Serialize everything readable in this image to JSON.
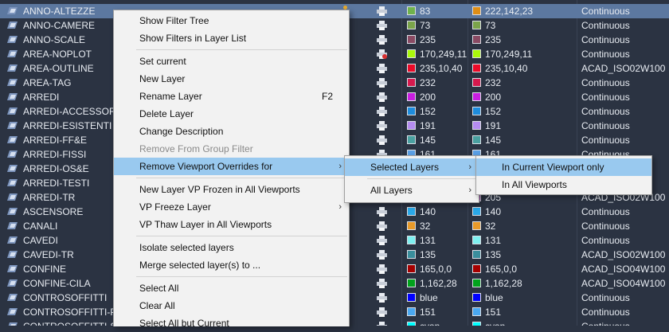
{
  "colors": {
    "selected_row": "#5c78a0",
    "table_bg": "#2b3342",
    "menu_bg": "#f2f2f2",
    "menu_highlight": "#99c9ef"
  },
  "layers": [
    {
      "name": "ANNO-ALTEZZE",
      "color": "83",
      "color_hex": "#6fb24c",
      "true_color": "222,142,23",
      "true_hex": "#de8e17",
      "linetype": "Continuous",
      "selected": true
    },
    {
      "name": "ANNO-CAMERE",
      "color": "73",
      "color_hex": "#7aa34a",
      "true_color": "73",
      "true_hex": "#7aa34a",
      "linetype": "Continuous"
    },
    {
      "name": "ANNO-SCALE",
      "color": "235",
      "color_hex": "#8a4a63",
      "true_color": "235",
      "true_hex": "#8a4a63",
      "linetype": "Continuous"
    },
    {
      "name": "AREA-NOPLOT",
      "color": "170,249,11",
      "color_hex": "#aaf90b",
      "true_color": "170,249,11",
      "true_hex": "#aaf90b",
      "linetype": "Continuous",
      "noplot": true
    },
    {
      "name": "AREA-OUTLINE",
      "color": "235,10,40",
      "color_hex": "#eb0a28",
      "true_color": "235,10,40",
      "true_hex": "#eb0a28",
      "linetype": "ACAD_ISO02W100"
    },
    {
      "name": "AREA-TAG",
      "color": "232",
      "color_hex": "#d61a4e",
      "true_color": "232",
      "true_hex": "#d61a4e",
      "linetype": "Continuous"
    },
    {
      "name": "ARREDI",
      "color": "200",
      "color_hex": "#c81ee0",
      "true_color": "200",
      "true_hex": "#c81ee0",
      "linetype": "Continuous"
    },
    {
      "name": "ARREDI-ACCESSORI",
      "color": "152",
      "color_hex": "#1e8cdc",
      "true_color": "152",
      "true_hex": "#1e8cdc",
      "linetype": "Continuous"
    },
    {
      "name": "ARREDI-ESISTENTI",
      "color": "191",
      "color_hex": "#b48cf0",
      "true_color": "191",
      "true_hex": "#b48cf0",
      "linetype": "Continuous"
    },
    {
      "name": "ARREDI-FF&E",
      "color": "145",
      "color_hex": "#4aa0a0",
      "true_color": "145",
      "true_hex": "#4aa0a0",
      "linetype": "Continuous"
    },
    {
      "name": "ARREDI-FISSI",
      "color": "161",
      "color_hex": "#5aa0e6",
      "true_color": "161",
      "true_hex": "#5aa0e6",
      "linetype": "Continuous"
    },
    {
      "name": "ARREDI-OS&E",
      "color": "",
      "color_hex": "#2f3848",
      "true_color": "",
      "true_hex": "#2f3848",
      "linetype": ""
    },
    {
      "name": "ARREDI-TESTI",
      "color": "",
      "color_hex": "#2f3848",
      "true_color": "",
      "true_hex": "#2f3848",
      "linetype": ""
    },
    {
      "name": "ARREDI-TR",
      "color": "",
      "color_hex": "#2f3848",
      "true_color": "205",
      "true_hex": "#b450c8",
      "linetype": "ACAD_ISO02W100"
    },
    {
      "name": "ASCENSORE",
      "color": "140",
      "color_hex": "#2aa8e8",
      "true_color": "140",
      "true_hex": "#2aa8e8",
      "linetype": "Continuous"
    },
    {
      "name": "CANALI",
      "color": "32",
      "color_hex": "#e89a2a",
      "true_color": "32",
      "true_hex": "#e89a2a",
      "linetype": "Continuous"
    },
    {
      "name": "CAVEDI",
      "color": "131",
      "color_hex": "#7ef0f0",
      "true_color": "131",
      "true_hex": "#7ef0f0",
      "linetype": "Continuous"
    },
    {
      "name": "CAVEDI-TR",
      "color": "135",
      "color_hex": "#3a8e9c",
      "true_color": "135",
      "true_hex": "#3a8e9c",
      "linetype": "ACAD_ISO02W100"
    },
    {
      "name": "CONFINE",
      "color": "165,0,0",
      "color_hex": "#a50000",
      "true_color": "165,0,0",
      "true_hex": "#a50000",
      "linetype": "ACAD_ISO04W100"
    },
    {
      "name": "CONFINE-CILA",
      "color": "1,162,28",
      "color_hex": "#01a21c",
      "true_color": "1,162,28",
      "true_hex": "#01a21c",
      "linetype": "ACAD_ISO04W100"
    },
    {
      "name": "CONTROSOFFITTI",
      "color": "blue",
      "color_hex": "#0000ff",
      "true_color": "blue",
      "true_hex": "#0000ff",
      "linetype": "Continuous"
    },
    {
      "name": "CONTROSOFFITTI-PA",
      "color": "151",
      "color_hex": "#4aa8f0",
      "true_color": "151",
      "true_hex": "#4aa8f0",
      "linetype": "Continuous"
    },
    {
      "name": "CONTROSOFFITTI-ST",
      "color": "cyan",
      "color_hex": "#00ffff",
      "true_color": "cyan",
      "true_hex": "#00ffff",
      "linetype": "Continuous"
    }
  ],
  "context_menu": {
    "items": [
      {
        "label": "Show Filter Tree"
      },
      {
        "label": "Show Filters in Layer List"
      },
      {
        "separator": true
      },
      {
        "label": "Set current"
      },
      {
        "label": "New Layer"
      },
      {
        "label": "Rename Layer",
        "shortcut": "F2"
      },
      {
        "label": "Delete Layer"
      },
      {
        "label": "Change Description"
      },
      {
        "label": "Remove From Group Filter",
        "disabled": true
      },
      {
        "label": "Remove Viewport Overrides for",
        "submenu": true,
        "highlighted": true
      },
      {
        "separator": true
      },
      {
        "label": "New Layer VP Frozen in All Viewports"
      },
      {
        "label": "VP Freeze Layer",
        "submenu": true
      },
      {
        "label": "VP Thaw Layer in All Viewports"
      },
      {
        "separator": true
      },
      {
        "label": "Isolate selected layers"
      },
      {
        "label": "Merge selected layer(s) to ..."
      },
      {
        "separator": true
      },
      {
        "label": "Select All"
      },
      {
        "label": "Clear All"
      },
      {
        "label": "Select All but Current"
      }
    ]
  },
  "submenu": {
    "items": [
      {
        "label": "Selected Layers",
        "submenu": true,
        "highlighted": true
      },
      {
        "separator": true
      },
      {
        "label": "All Layers",
        "submenu": true
      }
    ]
  },
  "submenu2": {
    "items": [
      {
        "label": "In Current Viewport only",
        "highlighted": true
      },
      {
        "label": "In All Viewports"
      }
    ]
  }
}
